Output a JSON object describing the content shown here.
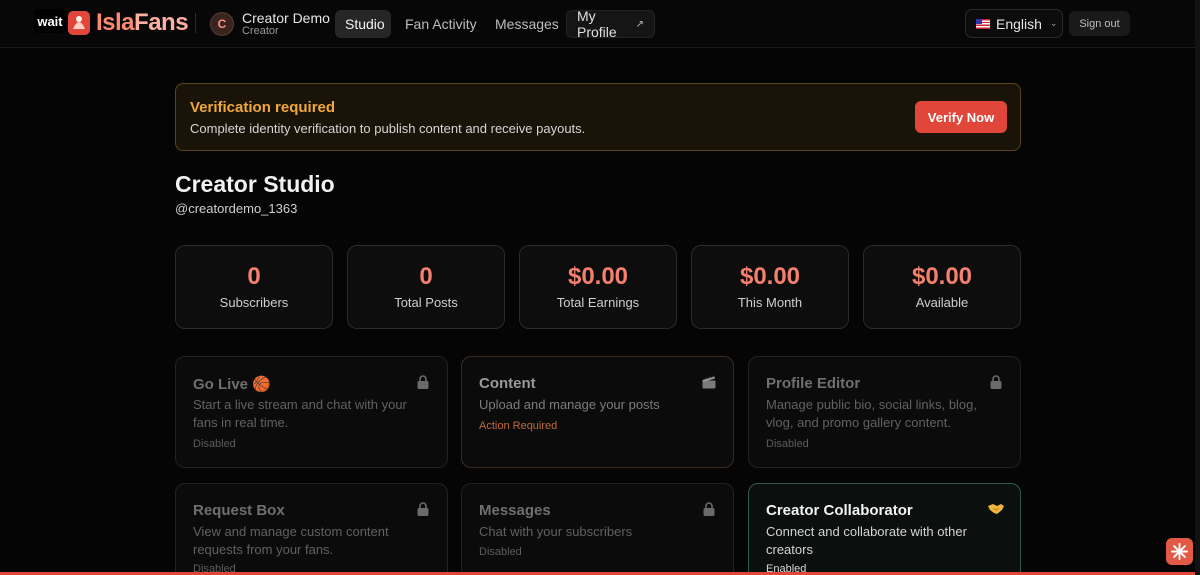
{
  "header": {
    "logo_wait": "wait",
    "logo_isla": "Isla",
    "logo_fans": "Fans",
    "avatar_initial": "C",
    "user_name": "Creator Demo",
    "user_role": "Creator",
    "nav": {
      "studio": "Studio",
      "fan_activity": "Fan Activity",
      "messages": "Messages",
      "my_profile": "My Profile",
      "my_profile_ext": "↗"
    },
    "language": "English",
    "sign_out": "Sign out"
  },
  "banner": {
    "title": "Verification required",
    "text": "Complete identity verification to publish content and receive payouts.",
    "button": "Verify Now"
  },
  "page": {
    "title": "Creator Studio",
    "handle": "@creatordemo_1363"
  },
  "stats": [
    {
      "value": "0",
      "label": "Subscribers"
    },
    {
      "value": "0",
      "label": "Total Posts"
    },
    {
      "value": "$0.00",
      "label": "Total Earnings"
    },
    {
      "value": "$0.00",
      "label": "This Month"
    },
    {
      "value": "$0.00",
      "label": "Available"
    }
  ],
  "cards": [
    {
      "title": "Go Live 🏀",
      "desc": "Start a live stream and chat with your fans in real time.",
      "status": "Disabled",
      "icon": "lock-icon"
    },
    {
      "title": "Content",
      "desc": "Upload and manage your posts",
      "status": "Action Required",
      "icon": "clapperboard-icon"
    },
    {
      "title": "Profile Editor",
      "desc": "Manage public bio, social links, blog, vlog, and promo gallery content.",
      "status": "Disabled",
      "icon": "lock-icon"
    },
    {
      "title": "Request Box",
      "desc": "View and manage custom content requests from your fans.",
      "status": "Disabled",
      "icon": "lock-icon"
    },
    {
      "title": "Messages",
      "desc": "Chat with your subscribers",
      "status": "Disabled",
      "icon": "lock-icon"
    },
    {
      "title": "Creator Collaborator",
      "desc": "Connect and collaborate with other creators",
      "status": "Enabled",
      "icon": "handshake-icon"
    }
  ],
  "colors": {
    "accent": "#e0473a",
    "stat_value": "#f4806d",
    "warning": "#f1a83a",
    "enabled_border": "#2f5a44"
  }
}
